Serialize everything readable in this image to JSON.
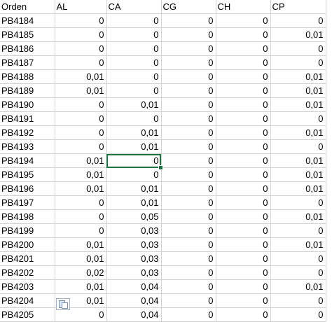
{
  "headers": [
    "Orden",
    "AL",
    "CA",
    "CG",
    "CH",
    "CP"
  ],
  "rows": [
    [
      "PB4184",
      "0",
      "0",
      "0",
      "0",
      "0"
    ],
    [
      "PB4185",
      "0",
      "0",
      "0",
      "0",
      "0,01"
    ],
    [
      "PB4186",
      "0",
      "0",
      "0",
      "0",
      "0"
    ],
    [
      "PB4187",
      "0",
      "0",
      "0",
      "0",
      "0"
    ],
    [
      "PB4188",
      "0,01",
      "0",
      "0",
      "0",
      "0,01"
    ],
    [
      "PB4189",
      "0,01",
      "0",
      "0",
      "0",
      "0,01"
    ],
    [
      "PB4190",
      "0",
      "0,01",
      "0",
      "0",
      "0,01"
    ],
    [
      "PB4191",
      "0",
      "0",
      "0",
      "0",
      "0"
    ],
    [
      "PB4192",
      "0",
      "0,01",
      "0",
      "0",
      "0,01"
    ],
    [
      "PB4193",
      "0",
      "0,01",
      "0",
      "0",
      "0"
    ],
    [
      "PB4194",
      "0,01",
      "0",
      "0",
      "0",
      "0,01"
    ],
    [
      "PB4195",
      "0,01",
      "0",
      "0",
      "0",
      "0,01"
    ],
    [
      "PB4196",
      "0,01",
      "0,01",
      "0",
      "0",
      "0,01"
    ],
    [
      "PB4197",
      "0",
      "0,01",
      "0",
      "0",
      "0"
    ],
    [
      "PB4198",
      "0",
      "0,05",
      "0",
      "0",
      "0,01"
    ],
    [
      "PB4199",
      "0",
      "0,03",
      "0",
      "0",
      "0"
    ],
    [
      "PB4200",
      "0,01",
      "0,03",
      "0",
      "0",
      "0,01"
    ],
    [
      "PB4201",
      "0,01",
      "0,03",
      "0",
      "0",
      "0"
    ],
    [
      "PB4202",
      "0,02",
      "0,03",
      "0",
      "0",
      "0"
    ],
    [
      "PB4203",
      "0,01",
      "0,04",
      "0",
      "0",
      "0,01"
    ],
    [
      "PB4204",
      "0,01",
      "0,04",
      "0",
      "0",
      "0"
    ],
    [
      "PB4205",
      "0",
      "0,04",
      "0",
      "0",
      "0"
    ]
  ],
  "selection": {
    "row": 10,
    "col": 2
  },
  "colors": {
    "selection": "#217346",
    "gridline": "#d4d4d4"
  },
  "icons": {
    "paste_options": "paste-options-icon"
  }
}
